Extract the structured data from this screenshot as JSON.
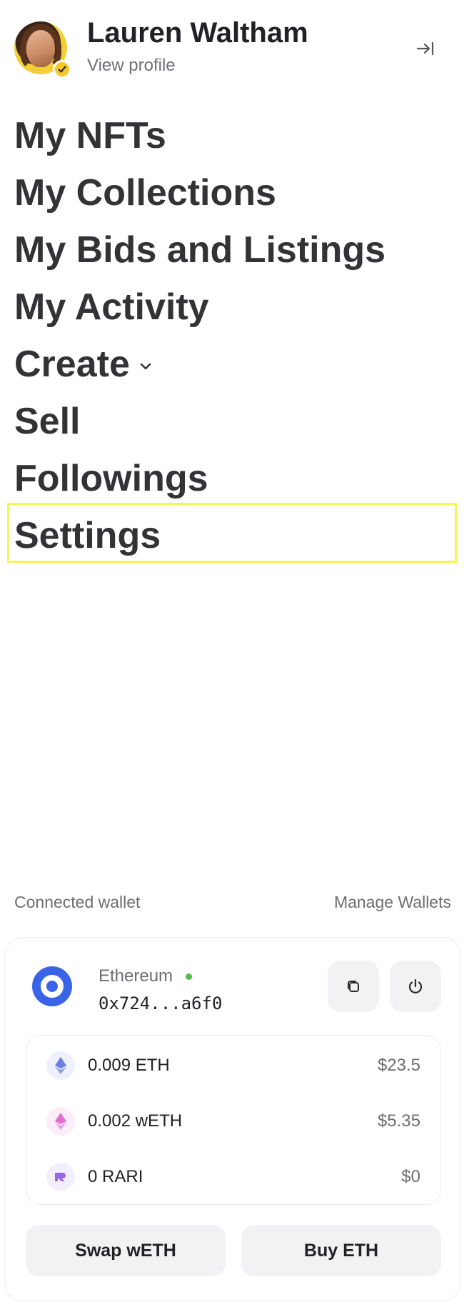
{
  "profile": {
    "name": "Lauren Waltham",
    "view_profile": "View profile"
  },
  "menu": [
    {
      "label": "My NFTs"
    },
    {
      "label": "My Collections"
    },
    {
      "label": "My Bids and Listings"
    },
    {
      "label": "My Activity"
    },
    {
      "label": "Create",
      "has_dropdown": true
    },
    {
      "label": "Sell"
    },
    {
      "label": "Followings"
    },
    {
      "label": "Settings",
      "highlighted": true
    }
  ],
  "wallet": {
    "connected_label": "Connected wallet",
    "manage_label": "Manage Wallets",
    "chain": "Ethereum",
    "status_color": "#4cbd49",
    "address": "0x724...a6f0",
    "balances": [
      {
        "token": "ETH",
        "amount": "0.009 ETH",
        "usd": "$23.5",
        "icon": "ethereum-icon"
      },
      {
        "token": "wETH",
        "amount": "0.002 wETH",
        "usd": "$5.35",
        "icon": "weth-icon"
      },
      {
        "token": "RARI",
        "amount": "0 RARI",
        "usd": "$0",
        "icon": "rari-icon"
      }
    ],
    "swap_label": "Swap wETH",
    "buy_label": "Buy ETH"
  },
  "colors": {
    "accent_yellow": "#f6c82a",
    "chain_blue": "#3a64e8",
    "highlight": "#f5f556"
  }
}
